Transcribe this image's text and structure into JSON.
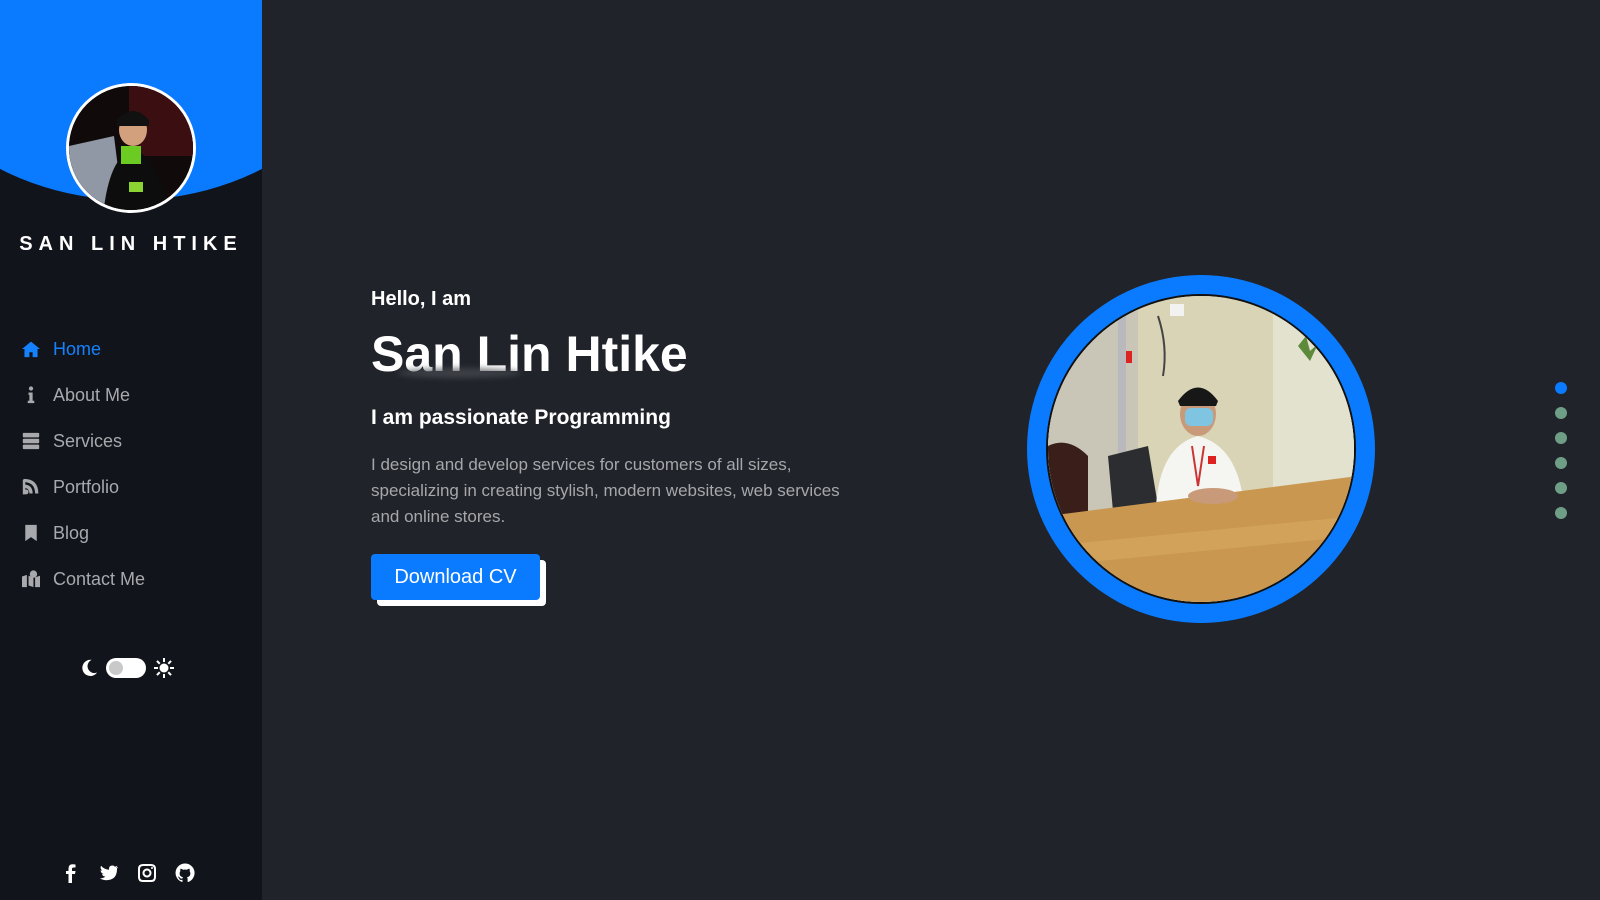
{
  "sidebar": {
    "brand": "SAN LIN HTIKE",
    "nav": [
      {
        "label": "Home",
        "icon": "home-icon",
        "active": true
      },
      {
        "label": "About Me",
        "icon": "info-icon",
        "active": false
      },
      {
        "label": "Services",
        "icon": "server-icon",
        "active": false
      },
      {
        "label": "Portfolio",
        "icon": "blog-icon",
        "active": false
      },
      {
        "label": "Blog",
        "icon": "bookmark-icon",
        "active": false
      },
      {
        "label": "Contact Me",
        "icon": "map-marked-icon",
        "active": false
      }
    ],
    "socials": [
      "facebook-icon",
      "twitter-icon",
      "instagram-icon",
      "github-icon"
    ]
  },
  "hero": {
    "greeting": "Hello, I am",
    "name": "San Lin Htike",
    "tagline": "I am passionate Programming",
    "description": "I design and develop services for customers of all sizes, specializing in creating stylish, modern websites, web services and online stores.",
    "cta_label": "Download CV"
  },
  "pagination": {
    "count": 6,
    "active_index": 0
  },
  "colors": {
    "accent": "#0a7bff",
    "background": "#202329",
    "sidebar": "#12141c"
  }
}
